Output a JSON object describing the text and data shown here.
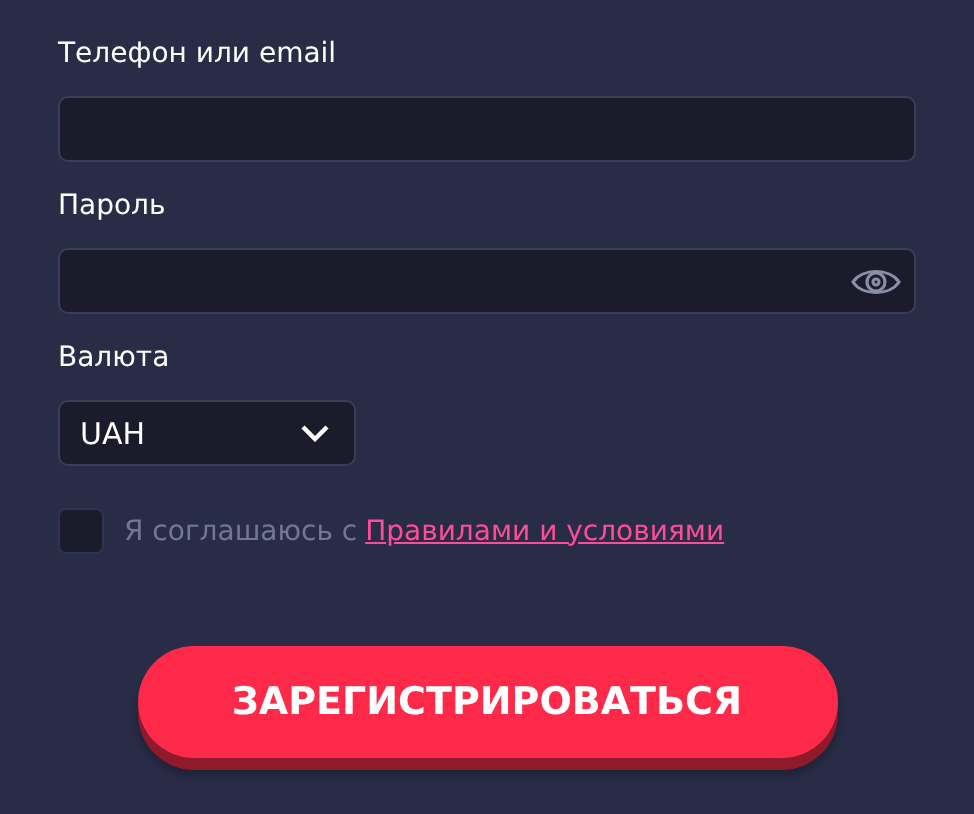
{
  "fields": [
    {
      "label": "Телефон или email",
      "kind": "text"
    },
    {
      "label": "Пароль",
      "kind": "password"
    }
  ],
  "currency": {
    "label": "Валюта",
    "value": "UAH"
  },
  "agreement": {
    "checked": false,
    "text": "Я соглашаюсь с",
    "link": "Правилами и условиями"
  },
  "submit": "ЗАРЕГИСТРИРОВАТЬСЯ"
}
